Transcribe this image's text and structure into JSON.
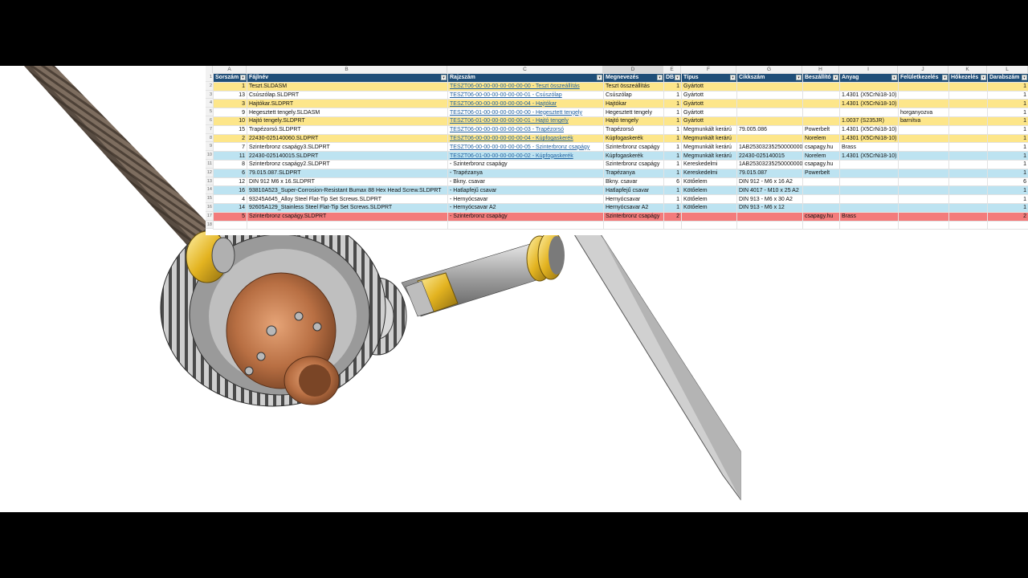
{
  "columns": [
    "A",
    "B",
    "C",
    "D",
    "E",
    "F",
    "G",
    "H",
    "I",
    "J",
    "K",
    "L"
  ],
  "row_numbers": [
    "1",
    "2",
    "3",
    "4",
    "5",
    "6",
    "7",
    "8",
    "9",
    "10",
    "11",
    "12",
    "13",
    "14",
    "15",
    "16",
    "17",
    "18"
  ],
  "headers": [
    "Sorszám",
    "Fájlnév",
    "Rajzszám",
    "Megnevezés",
    "DB",
    "Típus",
    "Cikkszám",
    "Beszállító",
    "Anyag",
    "Felületkezelés",
    "Hőkezelés",
    "Darabszám"
  ],
  "dropdown_glyph": "▾",
  "rows": [
    {
      "style": "yellow",
      "cells": [
        "1",
        "Teszt.SLDASM",
        "TESZT06-00-00-00-00-00-00-00 - Teszt összeállítás",
        "Teszt összeállítás",
        "1",
        "Gyártott",
        "",
        "",
        "",
        "",
        "",
        "1"
      ]
    },
    {
      "style": "white",
      "cells": [
        "13",
        "Csúszólap.SLDPRT",
        "TESZT06-00-00-00-00-00-00-01 - Csúszólap",
        "Csúszólap",
        "1",
        "Gyártott",
        "",
        "",
        "1.4301 (X5CrNi18-10)",
        "",
        "",
        "1"
      ]
    },
    {
      "style": "yellow",
      "cells": [
        "3",
        "Hajtókar.SLDPRT",
        "TESZT06-00-00-00-00-00-00-04 - Hajtókar",
        "Hajtókar",
        "1",
        "Gyártott",
        "",
        "",
        "1.4301 (X5CrNi18-10)",
        "",
        "",
        "1"
      ]
    },
    {
      "style": "white",
      "cells": [
        "9",
        "Hegesztett tengely.SLDASM",
        "TESZT06-01-00-00-00-00-00-00 - Hegesztett tengely",
        "Hegesztett tengely",
        "1",
        "Gyártott",
        "",
        "",
        "",
        "horganyozva",
        "",
        "1"
      ]
    },
    {
      "style": "yellow",
      "cells": [
        "10",
        "Hajtó tengely.SLDPRT",
        "TESZT06-01-00-00-00-00-00-01 - Hajtó tengely",
        "Hajtó tengely",
        "1",
        "Gyártott",
        "",
        "",
        "1.0037 (S235JR)",
        "barnítva",
        "",
        "1"
      ]
    },
    {
      "style": "white",
      "cells": [
        "15",
        "Trapézorsó.SLDPRT",
        "TESZT06-00-00-00-00-00-00-03 - Trapézorsó",
        "Trapézorsó",
        "1",
        "Megmunkált kerárú",
        "79.005.086",
        "Powerbelt",
        "1.4301 (X5CrNi18-10)",
        "",
        "",
        "1"
      ]
    },
    {
      "style": "yellow",
      "cells": [
        "2",
        "22430-025140060.SLDPRT",
        "TESZT06-00-00-00-00-00-00-04 - Kúpfogaskerék",
        "Kúpfogaskerék",
        "1",
        "Megmunkált kerárú",
        "",
        "Norelem",
        "1.4301 (X5CrNi18-10)",
        "",
        "",
        "1"
      ]
    },
    {
      "style": "white",
      "cells": [
        "7",
        "Szinterbronz csapágy3.SLDPRT",
        "TESZT06-00-00-00-00-00-00-05 - Szinterbronz csapágy",
        "Szinterbronz csapágy",
        "1",
        "Megmunkált kerárú",
        "1AB25303235250000000",
        "csapagy.hu",
        "Brass",
        "",
        "",
        "1"
      ]
    },
    {
      "style": "blue",
      "cells": [
        "11",
        "22430-025140015.SLDPRT",
        "TESZT06-01-00-00-00-00-00-02 - Kúpfogaskerék",
        "Kúpfogaskerék",
        "1",
        "Megmunkált kerárú",
        "22430-025140015",
        "Norelem",
        "1.4301 (X5CrNi18-10)",
        "",
        "",
        "1"
      ]
    },
    {
      "style": "white",
      "cells": [
        "8",
        "Szinterbronz csapágy2.SLDPRT",
        "- Szinterbronz csapágy",
        "Szinterbronz csapágy",
        "1",
        "Kereskedelmi",
        "1AB25303235250000000",
        "csapagy.hu",
        "",
        "",
        "",
        "1"
      ]
    },
    {
      "style": "blue",
      "cells": [
        "6",
        "79.015.087.SLDPRT",
        "- Trapézanya",
        "Trapézanya",
        "1",
        "Kereskedelmi",
        "79.015.087",
        "Powerbelt",
        "",
        "",
        "",
        "1"
      ]
    },
    {
      "style": "white",
      "cells": [
        "12",
        "DIN 912 M6 x 16.SLDPRT",
        "- Bkny. csavar",
        "Bkny. csavar",
        "6",
        "Kötőelem",
        "DIN 912 - M6 x 16 A2",
        "",
        "",
        "",
        "",
        "6"
      ]
    },
    {
      "style": "blue",
      "cells": [
        "16",
        "93810A523_Super-Corrosion-Resistant Bumax 88 Hex Head Screw.SLDPRT",
        "- Hatlapfejű csavar",
        "Hatlapfejű csavar",
        "1",
        "Kötőelem",
        "DIN 4017 - M10 x 25 A2",
        "",
        "",
        "",
        "",
        "1"
      ]
    },
    {
      "style": "white",
      "cells": [
        "4",
        "93245A645_Alloy Steel Flat-Tip Set Screws.SLDPRT",
        "- Hernyócsavar",
        "Hernyócsavar",
        "1",
        "Kötőelem",
        "DIN 913 - M6 x 30 A2",
        "",
        "",
        "",
        "",
        "1"
      ]
    },
    {
      "style": "blue",
      "cells": [
        "14",
        "92605A129_Stainless Steel Flat-Tip Set Screws.SLDPRT",
        "- Hernyócsavar A2",
        "Hernyócsavar A2",
        "1",
        "Kötőelem",
        "DIN 913 - M6 x 12",
        "",
        "",
        "",
        "",
        "1"
      ]
    },
    {
      "style": "red",
      "cells": [
        "5",
        "Szinterbronz csapágy.SLDPRT",
        "- Szinterbronz csapágy",
        "Szinterbronz csapágy",
        "2",
        "",
        "",
        "csapagy.hu",
        "Brass",
        "",
        "",
        "2"
      ]
    },
    {
      "style": "empty",
      "cells": [
        "",
        "",
        "",
        "",
        "",
        "",
        "",
        "",
        "",
        "",
        "",
        ""
      ]
    }
  ],
  "colors": {
    "header": "#1f4e78",
    "yellow": "#fde68a",
    "blue": "#bde3f1",
    "red": "#f37b7b",
    "link": "#1f5f9f",
    "brass": "#e0b21e",
    "copper": "#c7794a",
    "steel": "#8a8a8a"
  }
}
